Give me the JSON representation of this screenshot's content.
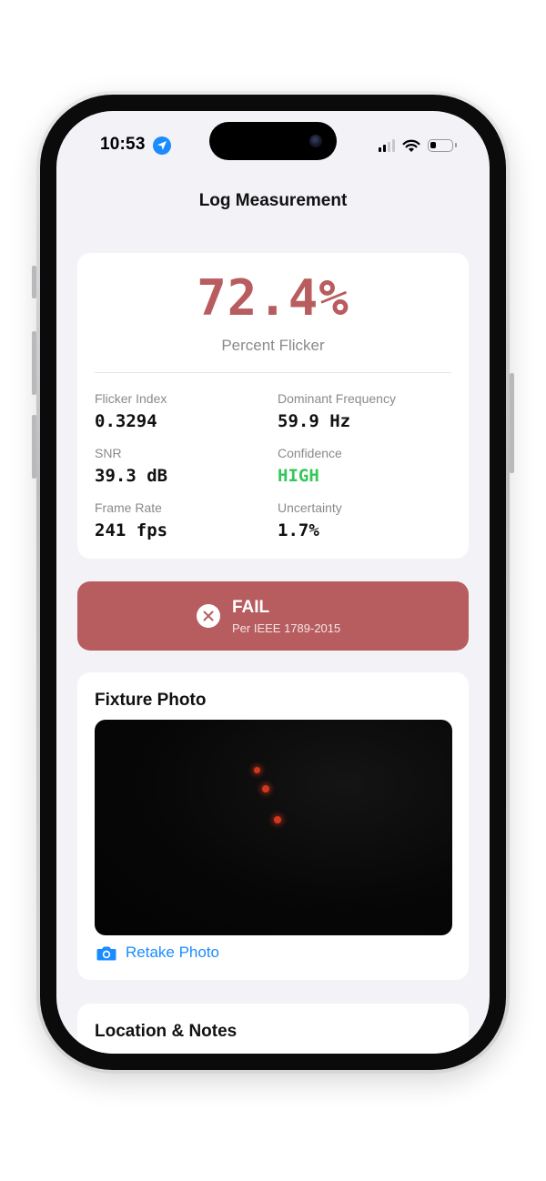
{
  "status_bar": {
    "time": "10:53"
  },
  "nav": {
    "title": "Log Measurement"
  },
  "summary": {
    "value": "72.4%",
    "label": "Percent Flicker"
  },
  "metrics": [
    {
      "label": "Flicker Index",
      "value": "0.3294"
    },
    {
      "label": "Dominant Frequency",
      "value": "59.9 Hz"
    },
    {
      "label": "SNR",
      "value": "39.3 dB"
    },
    {
      "label": "Confidence",
      "value": "HIGH"
    },
    {
      "label": "Frame Rate",
      "value": "241 fps"
    },
    {
      "label": "Uncertainty",
      "value": "1.7%"
    }
  ],
  "result": {
    "title": "FAIL",
    "subtitle": "Per IEEE 1789-2015"
  },
  "photo_section": {
    "title": "Fixture Photo",
    "retake_label": "Retake Photo"
  },
  "notes_section": {
    "title": "Location & Notes"
  },
  "colors": {
    "accent_blue": "#1a8cff",
    "fail_red": "#b75d60",
    "flicker_value": "#b85c5f",
    "confidence_green": "#34c759",
    "background": "#f2f2f7"
  },
  "icons": [
    "location-arrow-icon",
    "cellular-signal-icon",
    "wifi-icon",
    "battery-icon",
    "close-circle-icon",
    "camera-icon"
  ]
}
